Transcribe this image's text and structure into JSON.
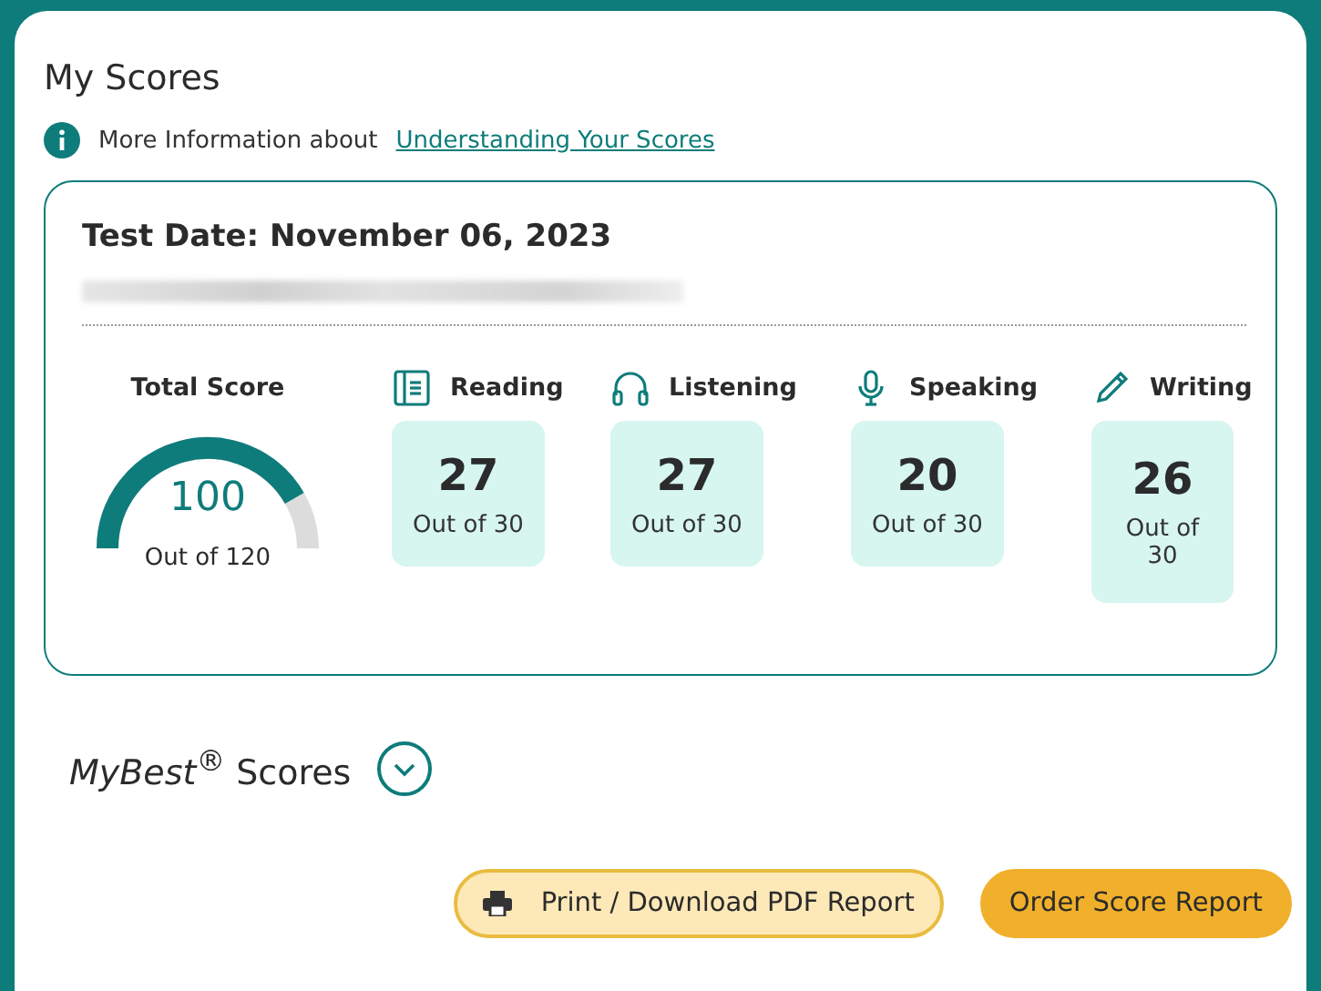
{
  "title": "My Scores",
  "info": {
    "text": "More Information about",
    "link": "Understanding Your Scores"
  },
  "score_card": {
    "test_date": "Test Date: November 06, 2023",
    "total": {
      "label": "Total Score",
      "score": "100",
      "out_of": "Out of 120"
    },
    "sections": [
      {
        "kind": "reading",
        "label": "Reading",
        "score": "27",
        "out_of": "Out of 30"
      },
      {
        "kind": "listening",
        "label": "Listening",
        "score": "27",
        "out_of": "Out of 30"
      },
      {
        "kind": "speaking",
        "label": "Speaking",
        "score": "20",
        "out_of": "Out of 30"
      },
      {
        "kind": "writing",
        "label": "Writing",
        "score": "26",
        "out_of": "Out of 30"
      }
    ]
  },
  "mybest": {
    "title": "*MyBest*$^{®}$ Scores",
    "expanded": false
  },
  "buttons": [
    {
      "kind": "secondary",
      "label": "Print / Download PDF Report"
    },
    {
      "kind": "primary",
      "label": "Order Score Report"
    }
  ]
}
